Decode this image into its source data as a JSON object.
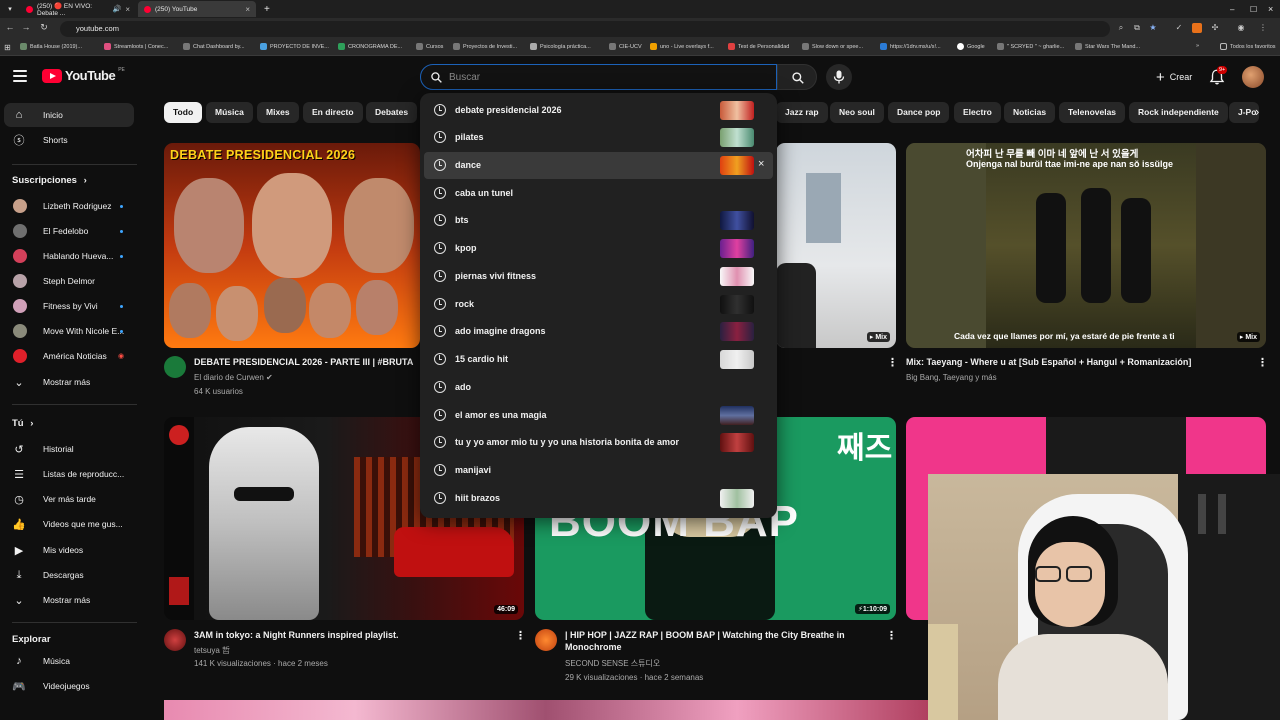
{
  "browser": {
    "tabs": [
      {
        "label": "(250) 🔴 EN VIVO: Debate ..."
      },
      {
        "label": "(250) YouTube"
      }
    ],
    "url": "youtube.com",
    "bookmarks": [
      "Batla House (2019)...",
      "Streamloots | Conec...",
      "Chat Dashboard by...",
      "PROYECTO DE INVE...",
      "CRONOGRAMA DE...",
      "Cursos",
      "Proyectos de Investi...",
      "Psicología práctica...",
      "CIE-UCV",
      "uno - Live overlays f...",
      "Test de Personalidad",
      "Slow down or spee...",
      "https://1drv.ms/u/s!...",
      "Google",
      "\" SCRYED \" ~ gharlie...",
      "Star Wars The Mand...",
      "Todos los favoritos"
    ]
  },
  "header": {
    "logo": "YouTube",
    "country_code": "PE",
    "search_placeholder": "Buscar",
    "create_label": "Crear",
    "notifications": "9+"
  },
  "sidebar": {
    "main": [
      {
        "label": "Inicio",
        "icon": "home-icon"
      },
      {
        "label": "Shorts",
        "icon": "shorts-icon"
      }
    ],
    "subscriptions_title": "Suscripciones",
    "subscriptions": [
      {
        "label": "Lizbeth Rodriguez",
        "color": "#c7a08a"
      },
      {
        "label": "El Fedelobo",
        "color": "#6f6f6f"
      },
      {
        "label": "Hablando Hueva...",
        "color": "#d4405a"
      },
      {
        "label": "Steph Delmor",
        "color": "#b8a2a8"
      },
      {
        "label": "Fitness by Vivi",
        "color": "#d0a0b8"
      },
      {
        "label": "Move With Nicole E...",
        "color": "#8a8a7a"
      },
      {
        "label": "América Noticias",
        "color": "#e0202a"
      }
    ],
    "subs_more": "Mostrar más",
    "you_title": "Tú",
    "you_items": [
      {
        "label": "Historial",
        "icon": "history-icon"
      },
      {
        "label": "Listas de reproducc...",
        "icon": "playlist-icon"
      },
      {
        "label": "Ver más tarde",
        "icon": "clock-icon"
      },
      {
        "label": "Videos que me gus...",
        "icon": "like-icon"
      },
      {
        "label": "Mis videos",
        "icon": "video-icon"
      },
      {
        "label": "Descargas",
        "icon": "download-icon"
      }
    ],
    "you_more": "Mostrar más",
    "explore_title": "Explorar",
    "explore_items": [
      {
        "label": "Música",
        "icon": "music-icon"
      },
      {
        "label": "Videojuegos",
        "icon": "gamepad-icon"
      }
    ]
  },
  "chips": [
    "Todo",
    "Música",
    "Mixes",
    "En directo",
    "Debates",
    "Jazz rap",
    "Neo soul",
    "Dance pop",
    "Electro",
    "Noticias",
    "Telenovelas",
    "Rock independiente",
    "J-Po"
  ],
  "suggestions": [
    "debate presidencial 2026",
    "pilates",
    "dance",
    "caba un tunel",
    "bts",
    "kpop",
    "piernas vivi fitness",
    "rock",
    "ado imagine dragons",
    "15 cardio hit",
    "ado",
    "el amor es una magia",
    "tu y yo amor mio tu y yo una historia bonita de amor",
    "manijavi",
    "hiit brazos"
  ],
  "videos": [
    {
      "thumb_text": "DEBATE PRESIDENCIAL 2026",
      "title": "DEBATE PRESIDENCIAL 2026 - PARTE III | #BRUTA",
      "channel": "El diario de Curwen",
      "meta": "64 K usuarios"
    },
    {
      "badge": "Mix"
    },
    {
      "title": "Mix: Taeyang - Where u at [Sub Español + Hangul + Romanización]",
      "channel": "Big Bang, Taeyang y más",
      "badge": "Mix",
      "subtitle_korean": "어차피 난 무를 빼 이마 네 앞에 난 서 있을게",
      "subtitle_roman": "Onjenga nal burŭl ttae imi-ne ape nan sŏ issŭlge",
      "subtitle_es": "Cada vez que llames por mí, ya estaré de pie frente a ti"
    },
    {
      "title": "3AM in tokyo: a Night Runners inspired playlist.",
      "channel": "tetsuya 哲",
      "meta": "141 K visualizaciones · hace 2 meses",
      "duration": "46:09"
    },
    {
      "thumb_text_top": "째즈",
      "thumb_text_main": "BOOM BAP",
      "title": "| HIP HOP | JAZZ RAP | BOOM BAP | Watching the City Breathe in Monochrome",
      "channel": "SECOND SENSE 스튜디오",
      "meta": "29 K visualizaciones · hace 2 semanas",
      "duration": "1:10:09"
    }
  ]
}
